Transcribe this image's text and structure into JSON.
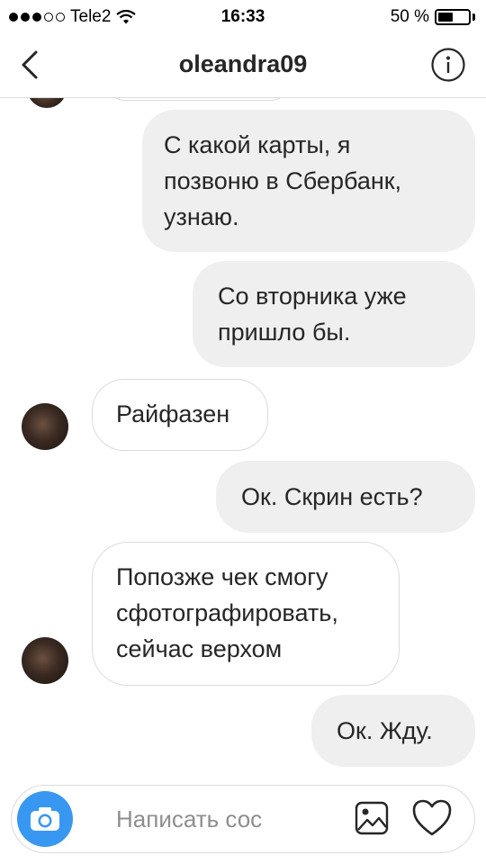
{
  "status_bar": {
    "carrier": "Tele2",
    "time": "16:33",
    "battery": "50 %",
    "battery_level": 0.5
  },
  "header": {
    "title": "oleandra09"
  },
  "messages": [
    {
      "from": "me",
      "text": "С какой карты, я\nпозвоню в Сбербанк,\nузнаю."
    },
    {
      "from": "me",
      "text": "Со вторника  уже\nпришло бы."
    },
    {
      "from": "them",
      "text": "Райфазен"
    },
    {
      "from": "me",
      "text": "Ок. Скрин есть?"
    },
    {
      "from": "them",
      "text": "Попозже чек смогу\nсфотографировать,\nсейчас верхом"
    },
    {
      "from": "me",
      "text": "Ок. Жду."
    }
  ],
  "composer": {
    "placeholder": "Написать сос"
  },
  "colors": {
    "accent": "#3897f0",
    "outgoing_bubble": "#efefef",
    "border": "#dbdbdb"
  }
}
